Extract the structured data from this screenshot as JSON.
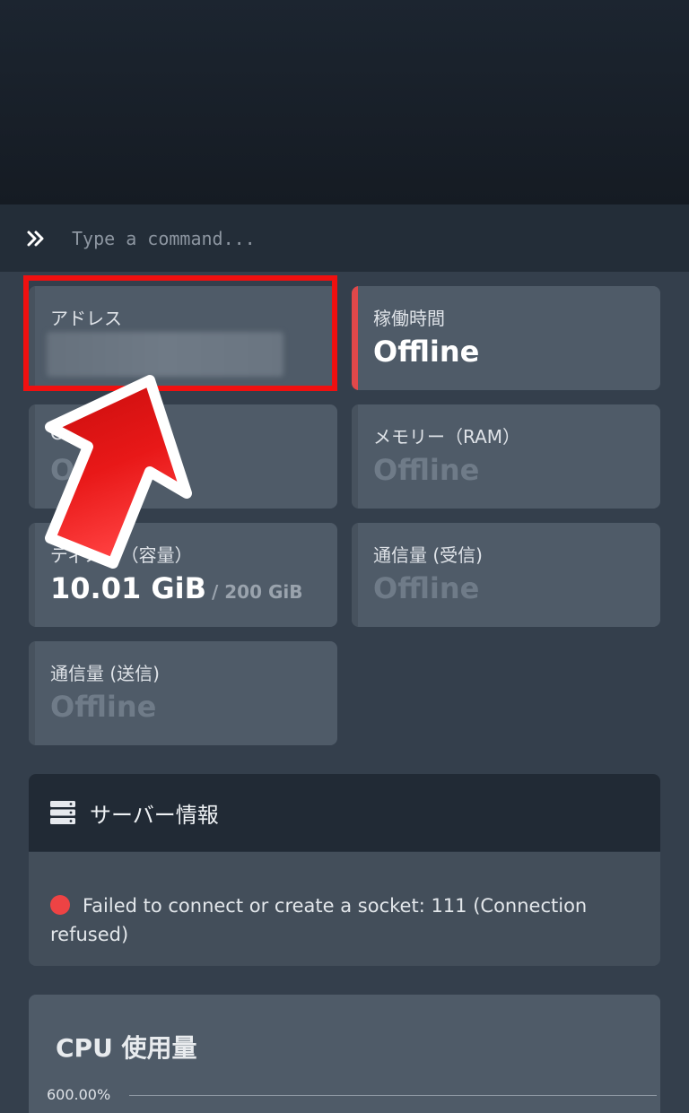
{
  "console": {
    "placeholder": "Type a command..."
  },
  "stats": {
    "address": {
      "label": "アドレス"
    },
    "uptime": {
      "label": "稼働時間",
      "value": "Offline"
    },
    "cpu": {
      "label": "CPU",
      "value": "Offline"
    },
    "memory": {
      "label": "メモリー（RAM）",
      "value": "Offline"
    },
    "disk": {
      "label": "ディスク（容量）",
      "value": "10.01 GiB",
      "limit": "/ 200 GiB"
    },
    "network_in": {
      "label": "通信量 (受信)",
      "value": "Offline"
    },
    "network_out": {
      "label": "通信量 (送信)",
      "value": "Offline"
    }
  },
  "server_info": {
    "title": "サーバー情報",
    "message": "Failed to connect or create a socket: 111 (Connection refused)"
  },
  "cpu_chart": {
    "title": "CPU 使用量",
    "tick_label": "600.00%"
  },
  "colors": {
    "accent_red": "#e0484a",
    "highlight": "#f01010",
    "status_error": "#ee4344"
  }
}
